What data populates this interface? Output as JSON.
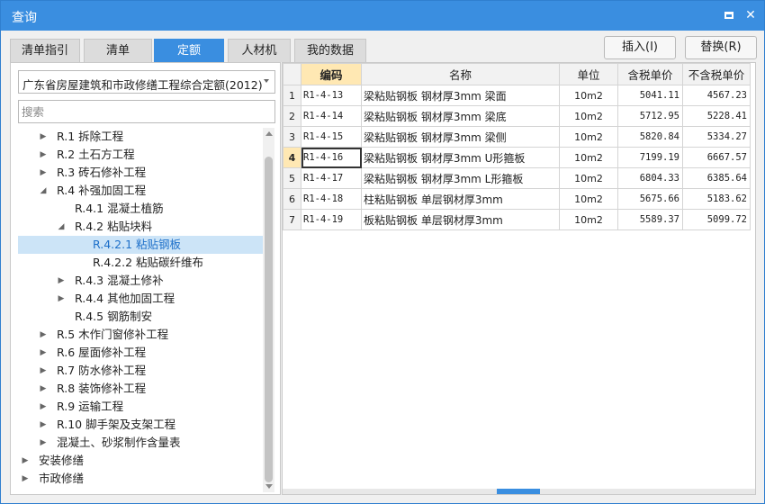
{
  "window": {
    "title": "查询"
  },
  "tabs": [
    "清单指引",
    "清单",
    "定额",
    "人材机",
    "我的数据"
  ],
  "actions": {
    "insert": "插入(I)",
    "replace": "替换(R)"
  },
  "left": {
    "select_value": "广东省房屋建筑和市政修缮工程综合定额(2012)",
    "search_placeholder": "搜索",
    "tree": [
      {
        "label": "R.1 拆除工程",
        "exp": "▶"
      },
      {
        "label": "R.2 土石方工程",
        "exp": "▶"
      },
      {
        "label": "R.3 砖石修补工程",
        "exp": "▶"
      },
      {
        "label": "R.4 补强加固工程",
        "exp": "◢"
      },
      {
        "label": "R.4.1 混凝土植筋",
        "exp": ""
      },
      {
        "label": "R.4.2 粘贴块料",
        "exp": "◢"
      },
      {
        "label": "R.4.2.1 粘贴钢板",
        "exp": ""
      },
      {
        "label": "R.4.2.2 粘贴碳纤维布",
        "exp": ""
      },
      {
        "label": "R.4.3 混凝土修补",
        "exp": "▶"
      },
      {
        "label": "R.4.4 其他加固工程",
        "exp": "▶"
      },
      {
        "label": "R.4.5 钢筋制安",
        "exp": ""
      },
      {
        "label": "R.5 木作门窗修补工程",
        "exp": "▶"
      },
      {
        "label": "R.6 屋面修补工程",
        "exp": "▶"
      },
      {
        "label": "R.7 防水修补工程",
        "exp": "▶"
      },
      {
        "label": "R.8 装饰修补工程",
        "exp": "▶"
      },
      {
        "label": "R.9 运输工程",
        "exp": "▶"
      },
      {
        "label": "R.10 脚手架及支架工程",
        "exp": "▶"
      },
      {
        "label": "混凝土、砂浆制作含量表",
        "exp": "▶"
      },
      {
        "label": "安装修缮",
        "exp": "▶"
      },
      {
        "label": "市政修缮",
        "exp": "▶"
      }
    ]
  },
  "table": {
    "headers": [
      "编码",
      "名称",
      "单位",
      "含税单价",
      "不含税单价"
    ],
    "rows": [
      [
        "1",
        "R1-4-13",
        "梁粘贴钢板 钢材厚3mm 梁面",
        "10m2",
        "5041.11",
        "4567.23"
      ],
      [
        "2",
        "R1-4-14",
        "梁粘贴钢板 钢材厚3mm 梁底",
        "10m2",
        "5712.95",
        "5228.41"
      ],
      [
        "3",
        "R1-4-15",
        "梁粘贴钢板 钢材厚3mm 梁侧",
        "10m2",
        "5820.84",
        "5334.27"
      ],
      [
        "4",
        "R1-4-16",
        "梁粘贴钢板 钢材厚3mm U形箍板",
        "10m2",
        "7199.19",
        "6667.57"
      ],
      [
        "5",
        "R1-4-17",
        "梁粘贴钢板 钢材厚3mm L形箍板",
        "10m2",
        "6804.33",
        "6385.64"
      ],
      [
        "6",
        "R1-4-18",
        "柱粘贴钢板 单层钢材厚3mm",
        "10m2",
        "5675.66",
        "5183.62"
      ],
      [
        "7",
        "R1-4-19",
        "板粘贴钢板 单层钢材厚3mm",
        "10m2",
        "5589.37",
        "5099.72"
      ]
    ]
  }
}
